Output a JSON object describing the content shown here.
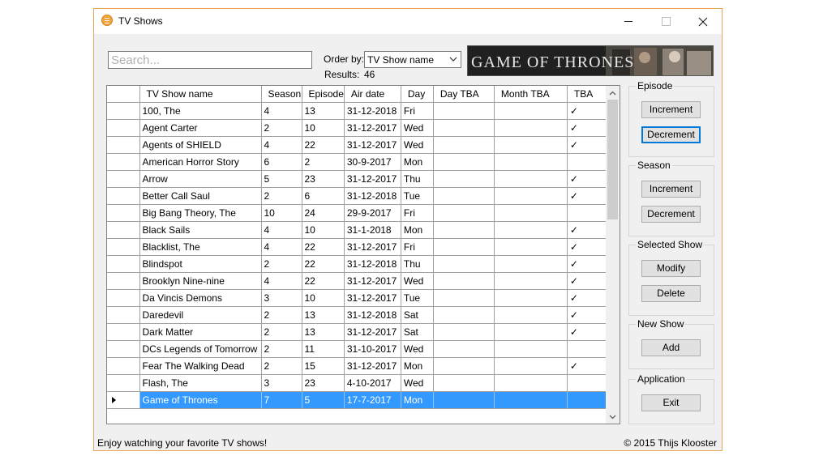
{
  "window": {
    "title": "TV Shows",
    "accent_color": "#e8a657"
  },
  "toolbar": {
    "search_placeholder": "Search...",
    "order_by_label": "Order by:",
    "order_by_value": "TV Show name",
    "results_label": "Results:",
    "results_value": "46",
    "banner_text": "GAME OF THRONES"
  },
  "grid": {
    "columns": [
      "TV Show name",
      "Season",
      "Episode",
      "Air date",
      "Day",
      "Day TBA",
      "Month TBA",
      "TBA"
    ],
    "rows": [
      {
        "name": "100, The",
        "season": "4",
        "episode": "13",
        "air_date": "31-12-2018",
        "day": "Fri",
        "day_tba": "",
        "month_tba": "",
        "tba": "✓"
      },
      {
        "name": "Agent Carter",
        "season": "2",
        "episode": "10",
        "air_date": "31-12-2017",
        "day": "Wed",
        "day_tba": "",
        "month_tba": "",
        "tba": "✓"
      },
      {
        "name": "Agents of SHIELD",
        "season": "4",
        "episode": "22",
        "air_date": "31-12-2017",
        "day": "Wed",
        "day_tba": "",
        "month_tba": "",
        "tba": "✓"
      },
      {
        "name": "American Horror Story",
        "season": "6",
        "episode": "2",
        "air_date": "30-9-2017",
        "day": "Mon",
        "day_tba": "",
        "month_tba": "",
        "tba": ""
      },
      {
        "name": "Arrow",
        "season": "5",
        "episode": "23",
        "air_date": "31-12-2017",
        "day": "Thu",
        "day_tba": "",
        "month_tba": "",
        "tba": "✓"
      },
      {
        "name": "Better Call Saul",
        "season": "2",
        "episode": "6",
        "air_date": "31-12-2018",
        "day": "Tue",
        "day_tba": "",
        "month_tba": "",
        "tba": "✓"
      },
      {
        "name": "Big Bang Theory, The",
        "season": "10",
        "episode": "24",
        "air_date": "29-9-2017",
        "day": "Fri",
        "day_tba": "",
        "month_tba": "",
        "tba": ""
      },
      {
        "name": "Black Sails",
        "season": "4",
        "episode": "10",
        "air_date": "31-1-2018",
        "day": "Mon",
        "day_tba": "",
        "month_tba": "",
        "tba": "✓"
      },
      {
        "name": "Blacklist, The",
        "season": "4",
        "episode": "22",
        "air_date": "31-12-2017",
        "day": "Fri",
        "day_tba": "",
        "month_tba": "",
        "tba": "✓"
      },
      {
        "name": "Blindspot",
        "season": "2",
        "episode": "22",
        "air_date": "31-12-2018",
        "day": "Thu",
        "day_tba": "",
        "month_tba": "",
        "tba": "✓"
      },
      {
        "name": "Brooklyn Nine-nine",
        "season": "4",
        "episode": "22",
        "air_date": "31-12-2017",
        "day": "Wed",
        "day_tba": "",
        "month_tba": "",
        "tba": "✓"
      },
      {
        "name": "Da Vincis Demons",
        "season": "3",
        "episode": "10",
        "air_date": "31-12-2017",
        "day": "Tue",
        "day_tba": "",
        "month_tba": "",
        "tba": "✓"
      },
      {
        "name": "Daredevil",
        "season": "2",
        "episode": "13",
        "air_date": "31-12-2018",
        "day": "Sat",
        "day_tba": "",
        "month_tba": "",
        "tba": "✓"
      },
      {
        "name": "Dark Matter",
        "season": "2",
        "episode": "13",
        "air_date": "31-12-2017",
        "day": "Sat",
        "day_tba": "",
        "month_tba": "",
        "tba": "✓"
      },
      {
        "name": "DCs Legends of Tomorrow",
        "season": "2",
        "episode": "11",
        "air_date": "31-10-2017",
        "day": "Wed",
        "day_tba": "",
        "month_tba": "",
        "tba": ""
      },
      {
        "name": "Fear The Walking Dead",
        "season": "2",
        "episode": "15",
        "air_date": "31-12-2017",
        "day": "Mon",
        "day_tba": "",
        "month_tba": "",
        "tba": "✓"
      },
      {
        "name": "Flash, The",
        "season": "3",
        "episode": "23",
        "air_date": "4-10-2017",
        "day": "Wed",
        "day_tba": "",
        "month_tba": "",
        "tba": ""
      },
      {
        "name": "Game of Thrones",
        "season": "7",
        "episode": "5",
        "air_date": "17-7-2017",
        "day": "Mon",
        "day_tba": "",
        "month_tba": "",
        "tba": "",
        "selected": true
      }
    ],
    "selection_color": "#3399ff"
  },
  "side": {
    "episode": {
      "label": "Episode",
      "increment": "Increment",
      "decrement": "Decrement"
    },
    "season": {
      "label": "Season",
      "increment": "Increment",
      "decrement": "Decrement"
    },
    "selected_show": {
      "label": "Selected Show",
      "modify": "Modify",
      "delete": "Delete"
    },
    "new_show": {
      "label": "New Show",
      "add": "Add"
    },
    "application": {
      "label": "Application",
      "exit": "Exit"
    }
  },
  "status": {
    "left": "Enjoy watching your favorite TV shows!",
    "right": "© 2015 Thijs Klooster"
  }
}
